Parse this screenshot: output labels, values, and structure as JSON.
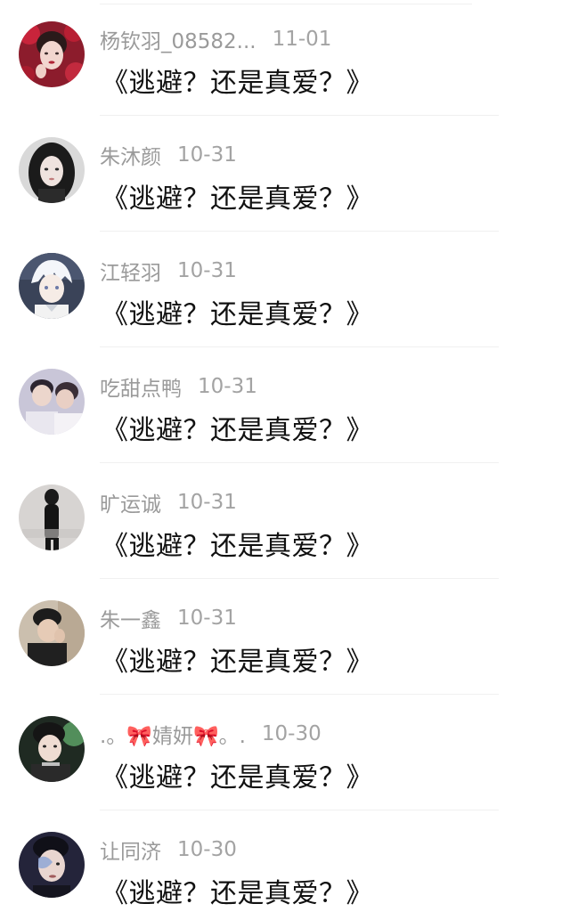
{
  "colors": {
    "name_text": "#9a9a9a",
    "date_text": "#a3a3a3",
    "comment_text": "#111111",
    "divider": "#f0f0f0",
    "background": "#ffffff"
  },
  "comments": [
    {
      "name": "杨钦羽_08582...",
      "date": "11-01",
      "text": "《逃避？还是真爱？》",
      "avatar": "avatar-girl-red-roses"
    },
    {
      "name": "朱沐颜",
      "date": "10-31",
      "text": "《逃避？还是真爱？》",
      "avatar": "avatar-girl-dark-hair"
    },
    {
      "name": "江轻羽",
      "date": "10-31",
      "text": "《逃避？还是真爱？》",
      "avatar": "avatar-anime-white-hair"
    },
    {
      "name": "吃甜点鸭",
      "date": "10-31",
      "text": "《逃避？还是真爱？》",
      "avatar": "avatar-two-people"
    },
    {
      "name": "旷运诚",
      "date": "10-31",
      "text": "《逃避？还是真爱？》",
      "avatar": "avatar-dark-figure"
    },
    {
      "name": "朱一鑫",
      "date": "10-31",
      "text": "《逃避？还是真爱？》",
      "avatar": "avatar-boy-cap"
    },
    {
      "name": ".。🎀婧妍🎀。.",
      "date": "10-30",
      "text": "《逃避？还是真爱？》",
      "avatar": "avatar-boy-green-light"
    },
    {
      "name": "让同济",
      "date": "10-30",
      "text": "《逃避？还是真爱？》",
      "avatar": "avatar-boy-face-paint"
    }
  ]
}
